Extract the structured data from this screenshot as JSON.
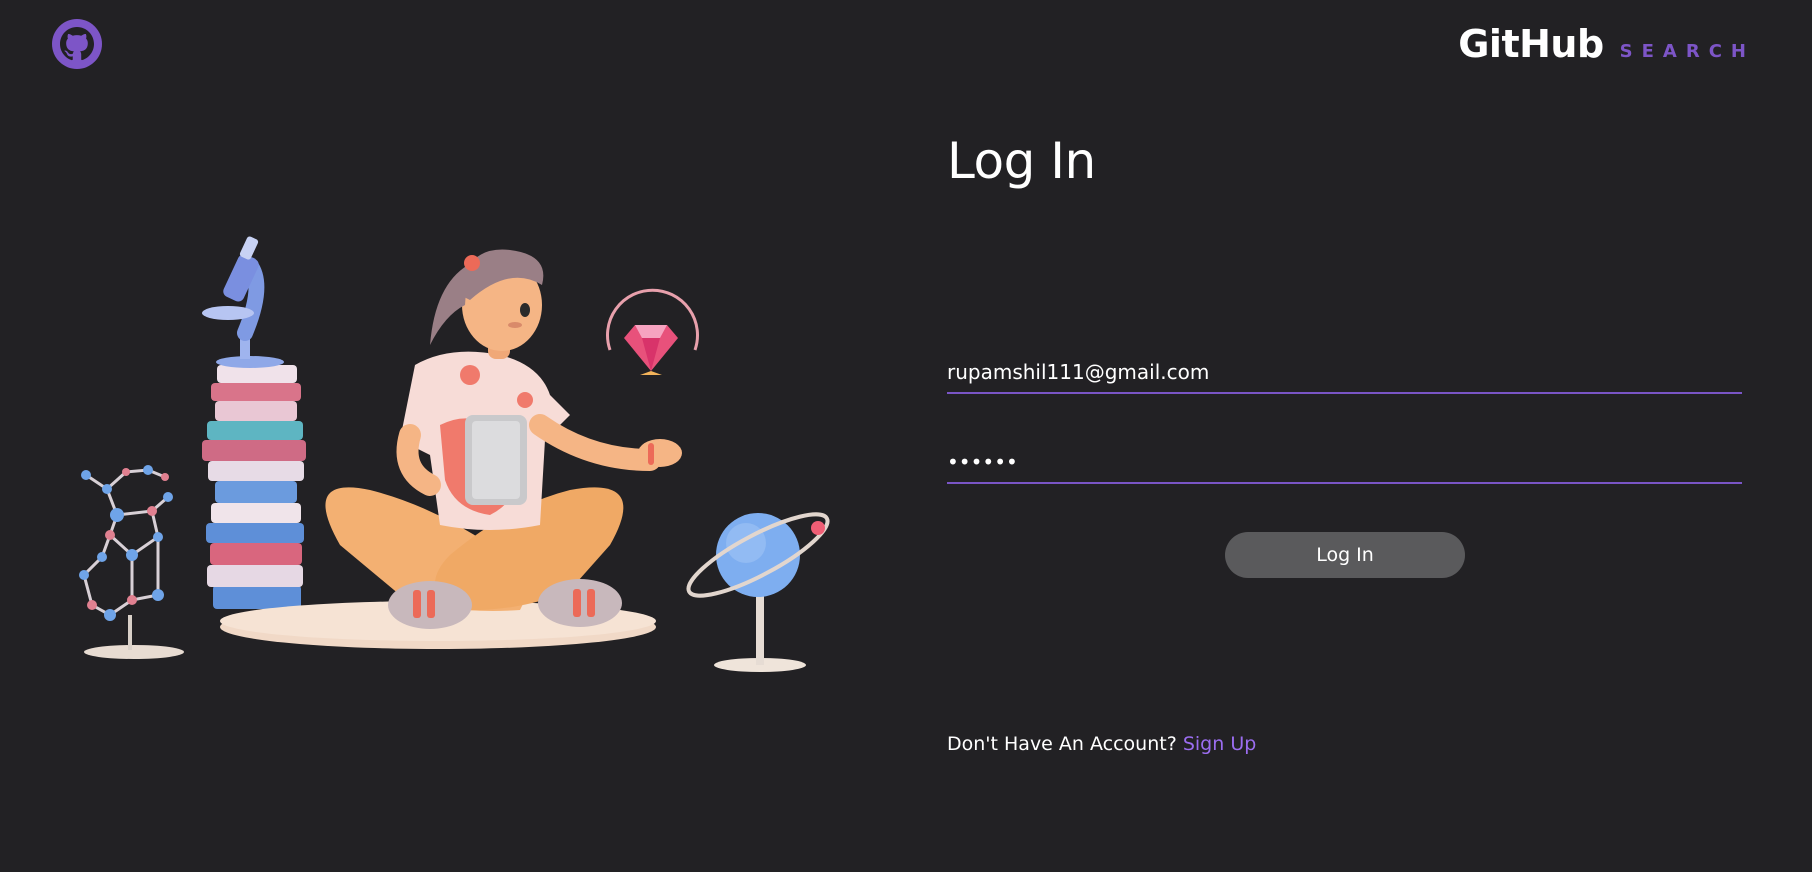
{
  "header": {
    "logo_icon": "github-octocat-icon",
    "brand_main": "GitHub",
    "brand_sub": "SEARCH",
    "accent_color": "#7d55c7"
  },
  "illustration": {
    "icons": [
      "molecule-icon",
      "microscope-icon",
      "books-stack-icon",
      "girl-with-tablet-icon",
      "gem-icon",
      "planet-globe-icon"
    ]
  },
  "login": {
    "title": "Log In",
    "email_value": "rupamshil111@gmail.com",
    "password_value": "••••••",
    "submit_label": "Log In",
    "signup_prompt": "Don't Have An Account?",
    "signup_link": "Sign Up",
    "link_color": "#9b6df0"
  }
}
